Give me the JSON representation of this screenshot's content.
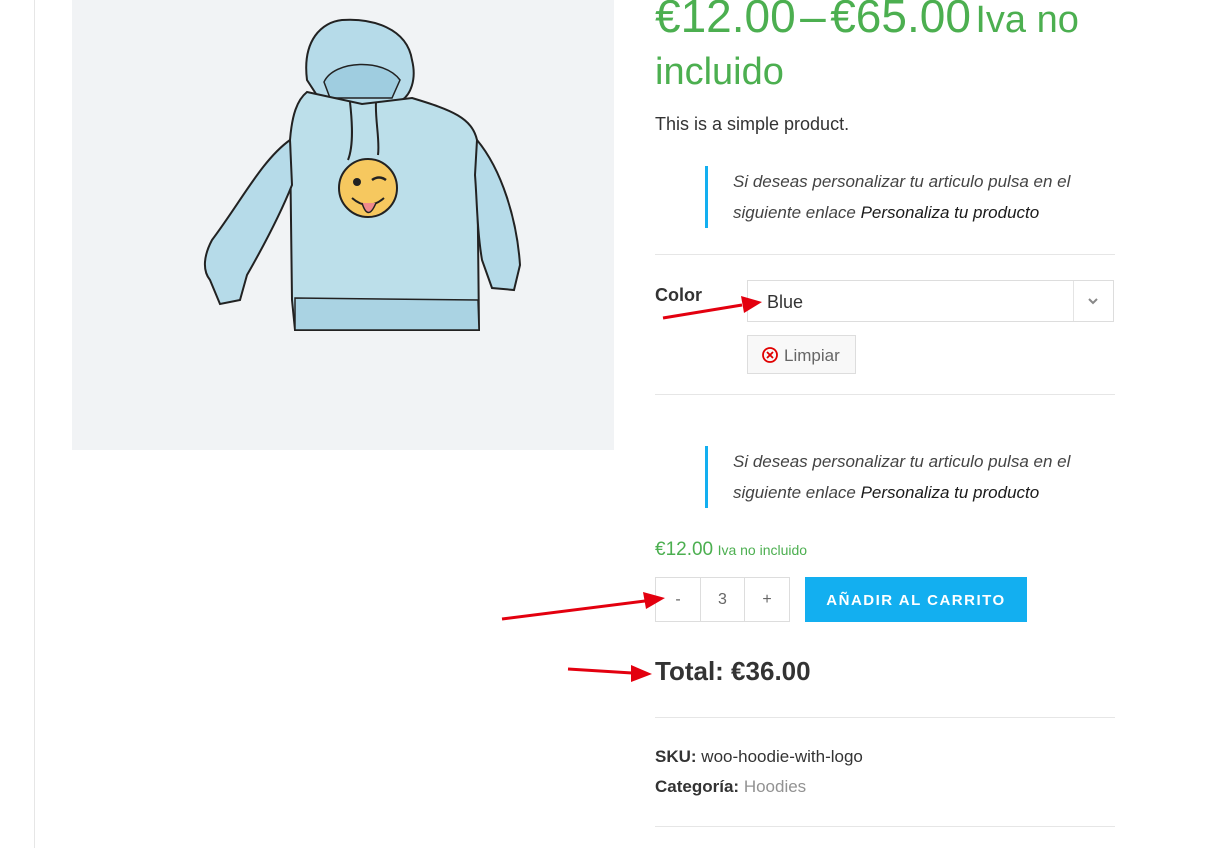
{
  "product": {
    "image_alt": "Hoodie with logo",
    "price_min": "€12.00",
    "price_sep": "–",
    "price_max": "€65.00",
    "price_suffix": "Iva no incluido",
    "short_description": "This is a simple product."
  },
  "customize_note": {
    "text": "Si deseas personalizar tu articulo pulsa en el siguiente enlace ",
    "link_text": "Personaliza tu producto"
  },
  "variation": {
    "label": "Color",
    "selected": "Blue",
    "clear_label": "Limpiar"
  },
  "variant_price": {
    "amount": "€12.00",
    "suffix": "Iva no incluido"
  },
  "cart": {
    "minus": "-",
    "quantity": "3",
    "plus": "+",
    "add_to_cart": "AÑADIR AL CARRITO"
  },
  "total": {
    "text": "Total: €36.00"
  },
  "meta": {
    "sku_label": "SKU:",
    "sku_value": "woo-hoodie-with-logo",
    "category_label": "Categoría:",
    "category_value": "Hoodies"
  },
  "colors": {
    "price_green": "#4caf50",
    "accent_blue": "#13aff0",
    "arrow_red": "#e3000f"
  }
}
